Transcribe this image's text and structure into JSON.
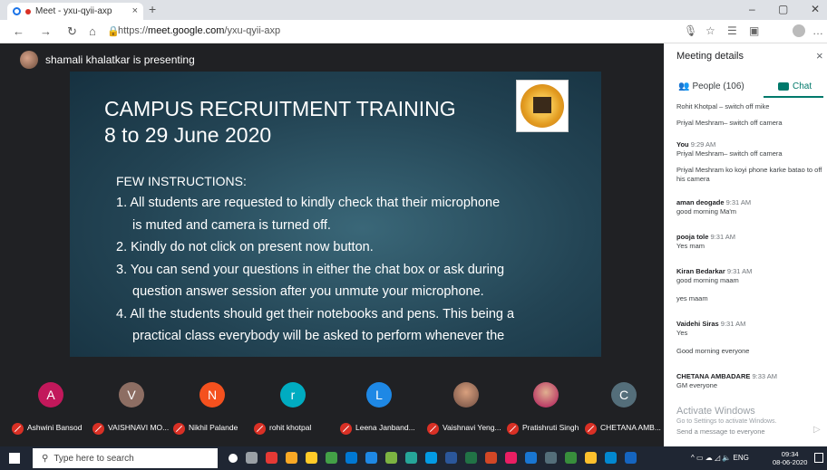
{
  "browser": {
    "tab_title": "Meet - yxu-qyii-axp",
    "tab_close": "×",
    "new_tab": "+",
    "url_prefix": "https://",
    "url_host": "meet.google.com",
    "url_path": "/yxu-qyii-axp",
    "win_minimize": "–",
    "win_restore": "▢",
    "win_close": "✕"
  },
  "meet": {
    "presenting_text": "shamali khalatkar is presenting"
  },
  "slide": {
    "title_line1": "CAMPUS RECRUITMENT TRAINING",
    "title_line2": "8 to 29 June 2020",
    "instructions_heading": "FEW INSTRUCTIONS:",
    "lines": [
      "1. All students are requested to kindly check that their microphone",
      "is muted and camera is turned off.",
      "2. Kindly do not click on present now button.",
      "3. You can send your questions in either the chat box or ask during",
      "question answer session after you unmute your microphone.",
      "4. All the students should get their notebooks and pens. This being a",
      "practical class everybody will be asked to perform whenever the"
    ]
  },
  "participants": [
    {
      "initial": "A",
      "name": "Ashwini Bansod",
      "color": "#c2185b"
    },
    {
      "initial": "V",
      "name": "VAISHNAVI MO...",
      "color": "#8d6e63"
    },
    {
      "initial": "N",
      "name": "Nikhil Palande",
      "color": "#f4511e"
    },
    {
      "initial": "r",
      "name": "rohit khotpal",
      "color": "#00acc1"
    },
    {
      "initial": "L",
      "name": "Leena Janband...",
      "color": "#1e88e5"
    },
    {
      "initial": "",
      "name": "Vaishnavi Yeng...",
      "color": "#6d4c41"
    },
    {
      "initial": "",
      "name": "Pratishruti Singh",
      "color": "#ad1457"
    },
    {
      "initial": "C",
      "name": "CHETANA AMB...",
      "color": "#546e7a"
    }
  ],
  "panel": {
    "title": "Meeting details",
    "close": "×",
    "people_tab": "People (106)",
    "chat_tab": "Chat",
    "messages": [
      {
        "sender": "",
        "time": "",
        "texts": [
          "Rohit Khotpal – switch off mike",
          "Priyal Meshram– switch off camera"
        ]
      },
      {
        "sender": "You",
        "time": "9:29 AM",
        "texts": [
          "Priyal Meshram– switch off camera",
          "Priyal Meshram ko koyi phone karke batao to off his camera"
        ]
      },
      {
        "sender": "aman deogade",
        "time": "9:31 AM",
        "texts": [
          "good morning Ma'm"
        ]
      },
      {
        "sender": "pooja tole",
        "time": "9:31 AM",
        "texts": [
          "Yes mam"
        ]
      },
      {
        "sender": "Kiran Bedarkar",
        "time": "9:31 AM",
        "texts": [
          "good morning maam",
          "yes maam"
        ]
      },
      {
        "sender": "Vaidehi Siras",
        "time": "9:31 AM",
        "texts": [
          "Yes",
          "Good morning everyone"
        ]
      },
      {
        "sender": "CHETANA AMBADARE",
        "time": "9:33 AM",
        "texts": [
          "GM everyone"
        ]
      }
    ],
    "watermark_title": "Activate Windows",
    "watermark_sub": "Go to Settings to activate Windows.",
    "send_placeholder": "Send a message to everyone"
  },
  "taskbar": {
    "search_placeholder": "Type here to search",
    "lang": "ENG",
    "time": "09:34",
    "date": "08-06-2020"
  }
}
